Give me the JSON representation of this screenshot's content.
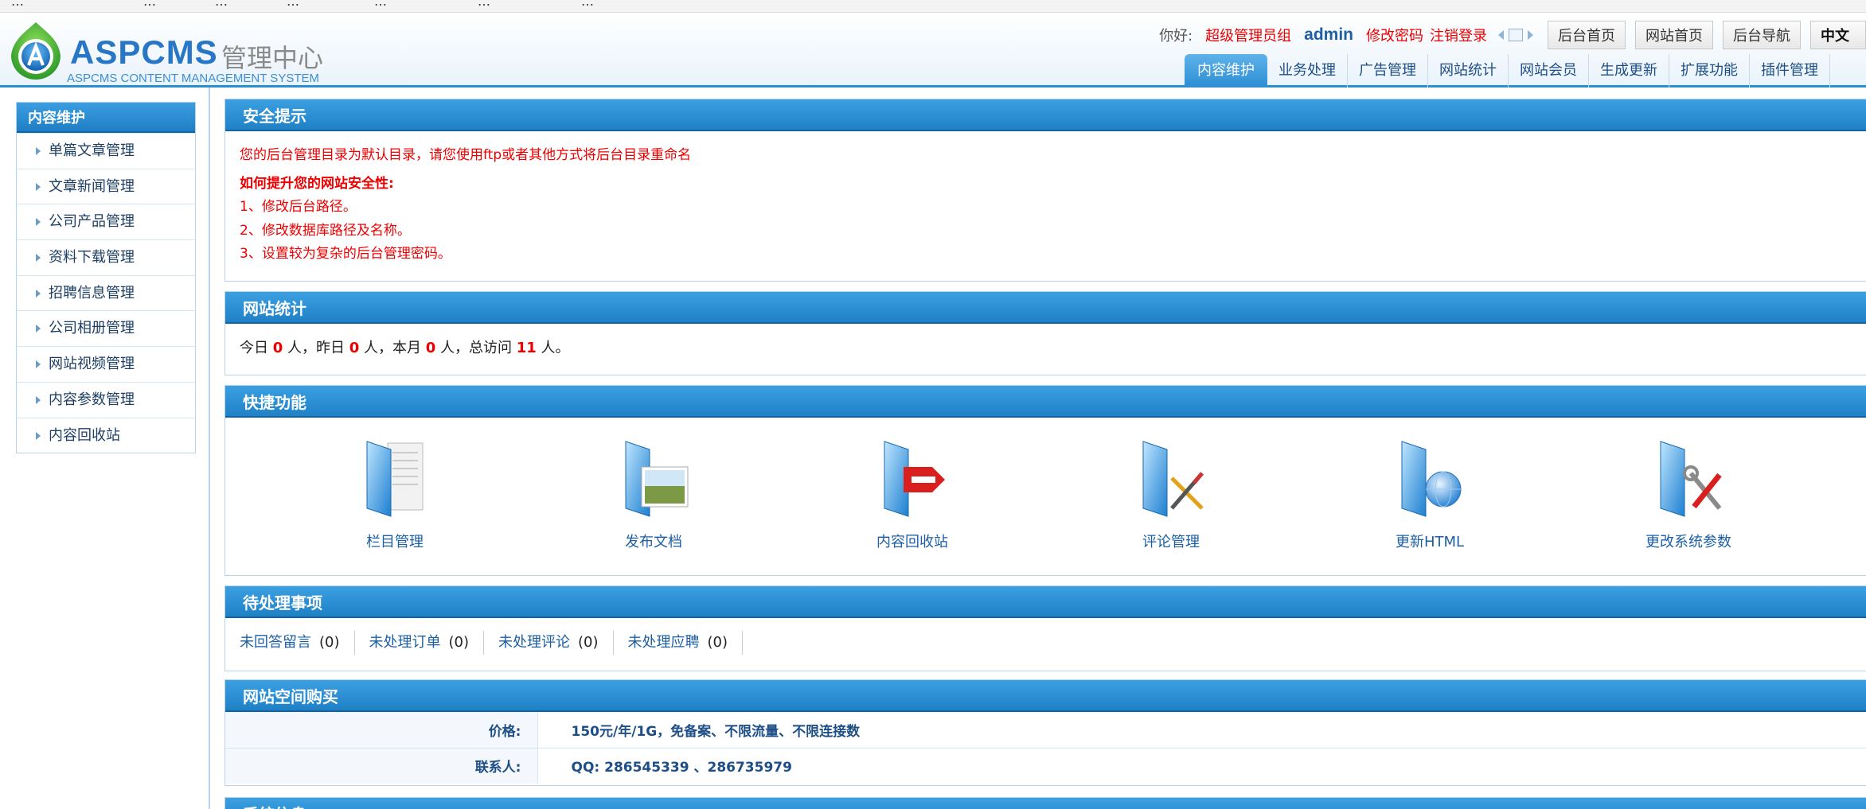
{
  "bookmarks": [
    "…",
    "…",
    "…",
    "…",
    "…",
    "…",
    "…"
  ],
  "header": {
    "logo_name": "ASPCMS",
    "logo_cn": "管理中心",
    "logo_sub": "ASPCMS CONTENT MANAGEMENT SYSTEM",
    "greeting": "你好:",
    "user_group": "超级管理员组",
    "username": "admin",
    "change_password": "修改密码",
    "logout": "注销登录",
    "buttons": [
      "后台首页",
      "网站首页",
      "后台导航"
    ],
    "language": "中文"
  },
  "tabs": [
    "内容维护",
    "业务处理",
    "广告管理",
    "网站统计",
    "网站会员",
    "生成更新",
    "扩展功能",
    "插件管理"
  ],
  "sidebar": {
    "title": "内容维护",
    "items": [
      "单篇文章管理",
      "文章新闻管理",
      "公司产品管理",
      "资料下载管理",
      "招聘信息管理",
      "公司相册管理",
      "网站视频管理",
      "内容参数管理",
      "内容回收站"
    ]
  },
  "security": {
    "title": "安全提示",
    "warning": "您的后台管理目录为默认目录，请您使用ftp或者其他方式将后台目录重命名",
    "howto": "如何提升您的网站安全性:",
    "tips": [
      "1、修改后台路径。",
      "2、修改数据库路径及名称。",
      "3、设置较为复杂的后台管理密码。"
    ]
  },
  "stats": {
    "title": "网站统计",
    "today_label": "今日",
    "today": "0",
    "yesterday_label": "人，昨日",
    "yesterday": "0",
    "month_label": "人，本月",
    "month": "0",
    "total_label": "人，总访问",
    "total": "11",
    "end_label": "人。"
  },
  "shortcuts": {
    "title": "快捷功能",
    "items": [
      {
        "label": "栏目管理",
        "icon": "folder-documents-icon"
      },
      {
        "label": "发布文档",
        "icon": "folder-image-icon"
      },
      {
        "label": "内容回收站",
        "icon": "folder-remove-icon"
      },
      {
        "label": "评论管理",
        "icon": "folder-pencil-icon"
      },
      {
        "label": "更新HTML",
        "icon": "folder-globe-icon"
      },
      {
        "label": "更改系统参数",
        "icon": "folder-tools-icon"
      }
    ]
  },
  "pending": {
    "title": "待处理事项",
    "items": [
      {
        "label": "未回答留言",
        "count": "(0)"
      },
      {
        "label": "未处理订单",
        "count": "(0)"
      },
      {
        "label": "未处理评论",
        "count": "(0)"
      },
      {
        "label": "未处理应聘",
        "count": "(0)"
      }
    ]
  },
  "purchase": {
    "title": "网站空间购买",
    "rows": [
      {
        "key": "价格:",
        "value": "150元/年/1G，免备案、不限流量、不限连接数"
      },
      {
        "key": "联系人:",
        "value": "QQ: 286545339 、286735979"
      }
    ]
  },
  "sysinfo": {
    "title": "系统信息"
  },
  "colors": {
    "accent": "#2a8fd0",
    "warning": "#ee0000",
    "link": "#1d5fa5"
  }
}
